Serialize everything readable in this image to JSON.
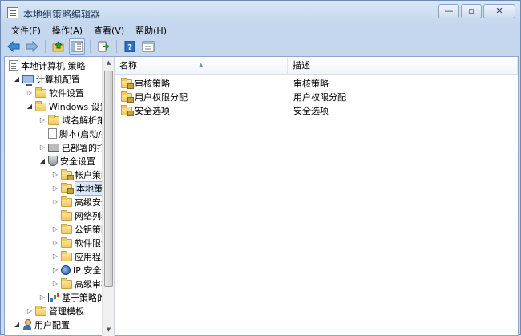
{
  "window": {
    "title": "本地组策略编辑器",
    "buttons": {
      "minimize": "—",
      "maximize": "▫",
      "close": "✕"
    }
  },
  "menu": [
    "文件(F)",
    "操作(A)",
    "查看(V)",
    "帮助(H)"
  ],
  "toolbar": [
    "back-icon",
    "forward-icon",
    "up-icon",
    "show-hide-tree-icon",
    "export-icon",
    "help-icon",
    "properties-icon"
  ],
  "tree": {
    "items": [
      {
        "label": "本地计算机 策略"
      },
      {
        "label": "计算机配置"
      },
      {
        "label": "软件设置"
      },
      {
        "label": "Windows 设置"
      },
      {
        "label": "域名解析策略"
      },
      {
        "label": "脚本(启动/关机)"
      },
      {
        "label": "已部署的打印机"
      },
      {
        "label": "安全设置"
      },
      {
        "label": "帐户策略"
      },
      {
        "label": "本地策略"
      },
      {
        "label": "高级安全"
      },
      {
        "label": "网络列表"
      },
      {
        "label": "公钥策略"
      },
      {
        "label": "软件限制"
      },
      {
        "label": "应用程序"
      },
      {
        "label": "IP 安全策略"
      },
      {
        "label": "高级审核"
      },
      {
        "label": "基于策略的"
      },
      {
        "label": "管理模板"
      },
      {
        "label": "用户配置"
      }
    ]
  },
  "list": {
    "columns": [
      "名称",
      "描述"
    ],
    "rows": [
      {
        "name": "审核策略",
        "desc": "审核策略"
      },
      {
        "name": "用户权限分配",
        "desc": "用户权限分配"
      },
      {
        "name": "安全选项",
        "desc": "安全选项"
      }
    ]
  },
  "scrollbar": {
    "up": "▲",
    "down": "▼"
  }
}
